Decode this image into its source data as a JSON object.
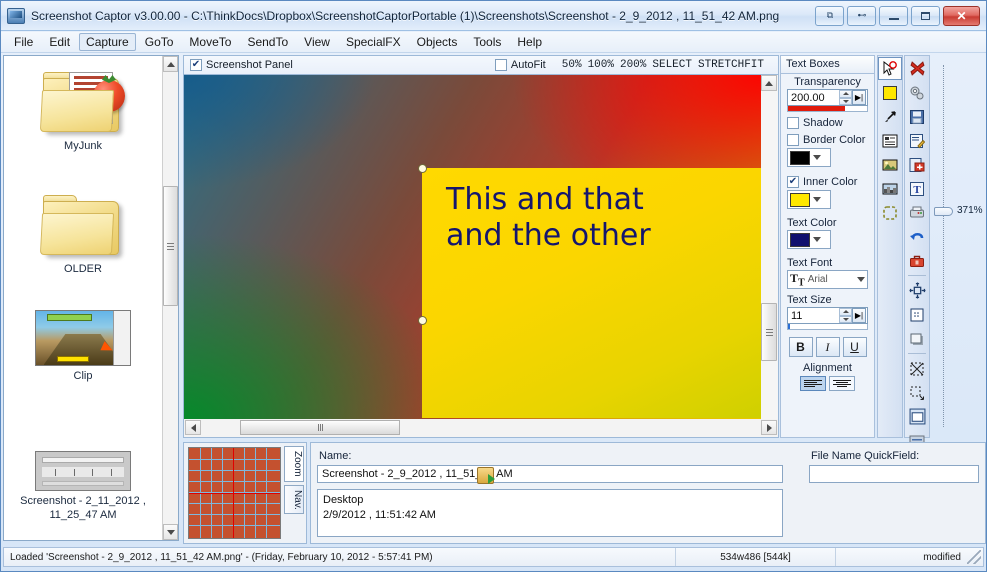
{
  "window": {
    "title": "Screenshot Captor v3.00.00 - C:\\ThinkDocs\\Dropbox\\ScreenshotCaptorPortable (1)\\Screenshots\\Screenshot - 2_9_2012 , 11_51_42 AM.png",
    "app_icon": "monitor-icon",
    "buttons": {
      "extra1": "⧉",
      "extra2": "⊷",
      "minimize": "minimize-icon",
      "maximize": "maximize-icon",
      "close": "✕"
    }
  },
  "menu": {
    "items": [
      {
        "label": "File",
        "active": false
      },
      {
        "label": "Edit",
        "active": false
      },
      {
        "label": "Capture",
        "active": true
      },
      {
        "label": "GoTo",
        "active": false
      },
      {
        "label": "MoveTo",
        "active": false
      },
      {
        "label": "SendTo",
        "active": false
      },
      {
        "label": "View",
        "active": false
      },
      {
        "label": "SpecialFX",
        "active": false
      },
      {
        "label": "Objects",
        "active": false
      },
      {
        "label": "Tools",
        "active": false
      },
      {
        "label": "Help",
        "active": false
      }
    ]
  },
  "sidebar": {
    "items": [
      {
        "label": "MyJunk",
        "kind": "folder-with-doc"
      },
      {
        "label": "OLDER",
        "kind": "folder"
      },
      {
        "label": "Clip",
        "kind": "image-thumb"
      },
      {
        "label": "Screenshot - 2_11_2012 , 11_25_47 AM",
        "kind": "screenshot-thumb"
      }
    ]
  },
  "editor_toolbar": {
    "panel_checkbox_label": "Screenshot Panel",
    "panel_checked": true,
    "autofit_label": "AutoFit",
    "autofit_checked": false,
    "zoom_options": [
      "50%",
      "100%",
      "200%",
      "SELECT",
      "STRETCHFIT"
    ]
  },
  "canvas": {
    "textbox_text": "This and that\nand the other",
    "textbox_fill": "#ffd900",
    "textbox_text_color": "#14166e"
  },
  "properties": {
    "tab_label": "Text Boxes",
    "transparency_label": "Transparency",
    "transparency_value": "200.00",
    "shadow_label": "Shadow",
    "shadow_checked": false,
    "border_color_label": "Border Color",
    "border_color_checked": false,
    "border_color": "#000000",
    "inner_color_label": "Inner Color",
    "inner_color_checked": true,
    "inner_color": "#ffe800",
    "text_color_label": "Text Color",
    "text_color": "#11116e",
    "text_font_label": "Text Font",
    "text_font_value": "Arial",
    "text_size_label": "Text Size",
    "text_size_value": "11",
    "bold_label": "B",
    "italic_label": "I",
    "underline_label": "U",
    "alignment_label": "Alignment"
  },
  "tool_column_a": [
    {
      "icon": "pointer-select-icon",
      "selected": true
    },
    {
      "icon": "fill-color-icon",
      "selected": false
    },
    {
      "icon": "arrow-object-icon",
      "selected": false
    },
    {
      "icon": "text-box-icon",
      "selected": false
    },
    {
      "icon": "image-object-icon",
      "selected": false
    },
    {
      "icon": "pixelate-icon",
      "selected": false
    },
    {
      "icon": "selection-region-icon",
      "selected": false
    }
  ],
  "tool_column_b": [
    {
      "icon": "delete-red-x-icon"
    },
    {
      "icon": "settings-gears-icon"
    },
    {
      "icon": "save-disk-icon"
    },
    {
      "icon": "edit-pencil-icon"
    },
    {
      "icon": "add-new-icon"
    },
    {
      "icon": "text-tool-icon"
    },
    {
      "icon": "printer-icon"
    },
    {
      "icon": "undo-arrow-icon"
    },
    {
      "icon": "toolbox-icon"
    },
    {
      "icon": "resize-canvas-icon"
    },
    {
      "icon": "crop-border-icon"
    },
    {
      "icon": "shadow-box-icon"
    },
    {
      "icon": "clear-selection-icon"
    },
    {
      "icon": "crop-tool-icon"
    },
    {
      "icon": "window-frame-icon"
    },
    {
      "icon": "thumbnail-view-icon"
    }
  ],
  "zoom_slider": {
    "value_label": "371%"
  },
  "nav_panel": {
    "tabs": [
      {
        "label": "Zoom",
        "selected": true
      },
      {
        "label": "Nav.",
        "selected": false
      }
    ]
  },
  "info_panel": {
    "name_label": "Name:",
    "name_value": "Screenshot - 2_9_2012 , 11_51_42 AM",
    "details_value": "Desktop\n2/9/2012 , 11:51:42 AM",
    "quickfield_label": "File Name QuickField:",
    "quickfield_value": "",
    "quickfield_placeholder": ""
  },
  "statusbar": {
    "message": "Loaded 'Screenshot - 2_9_2012 , 11_51_42 AM.png'  -  (Friday, February 10, 2012 - 5:57:41 PM)",
    "dimensions": "534w486  [544k]",
    "state": "modified"
  }
}
